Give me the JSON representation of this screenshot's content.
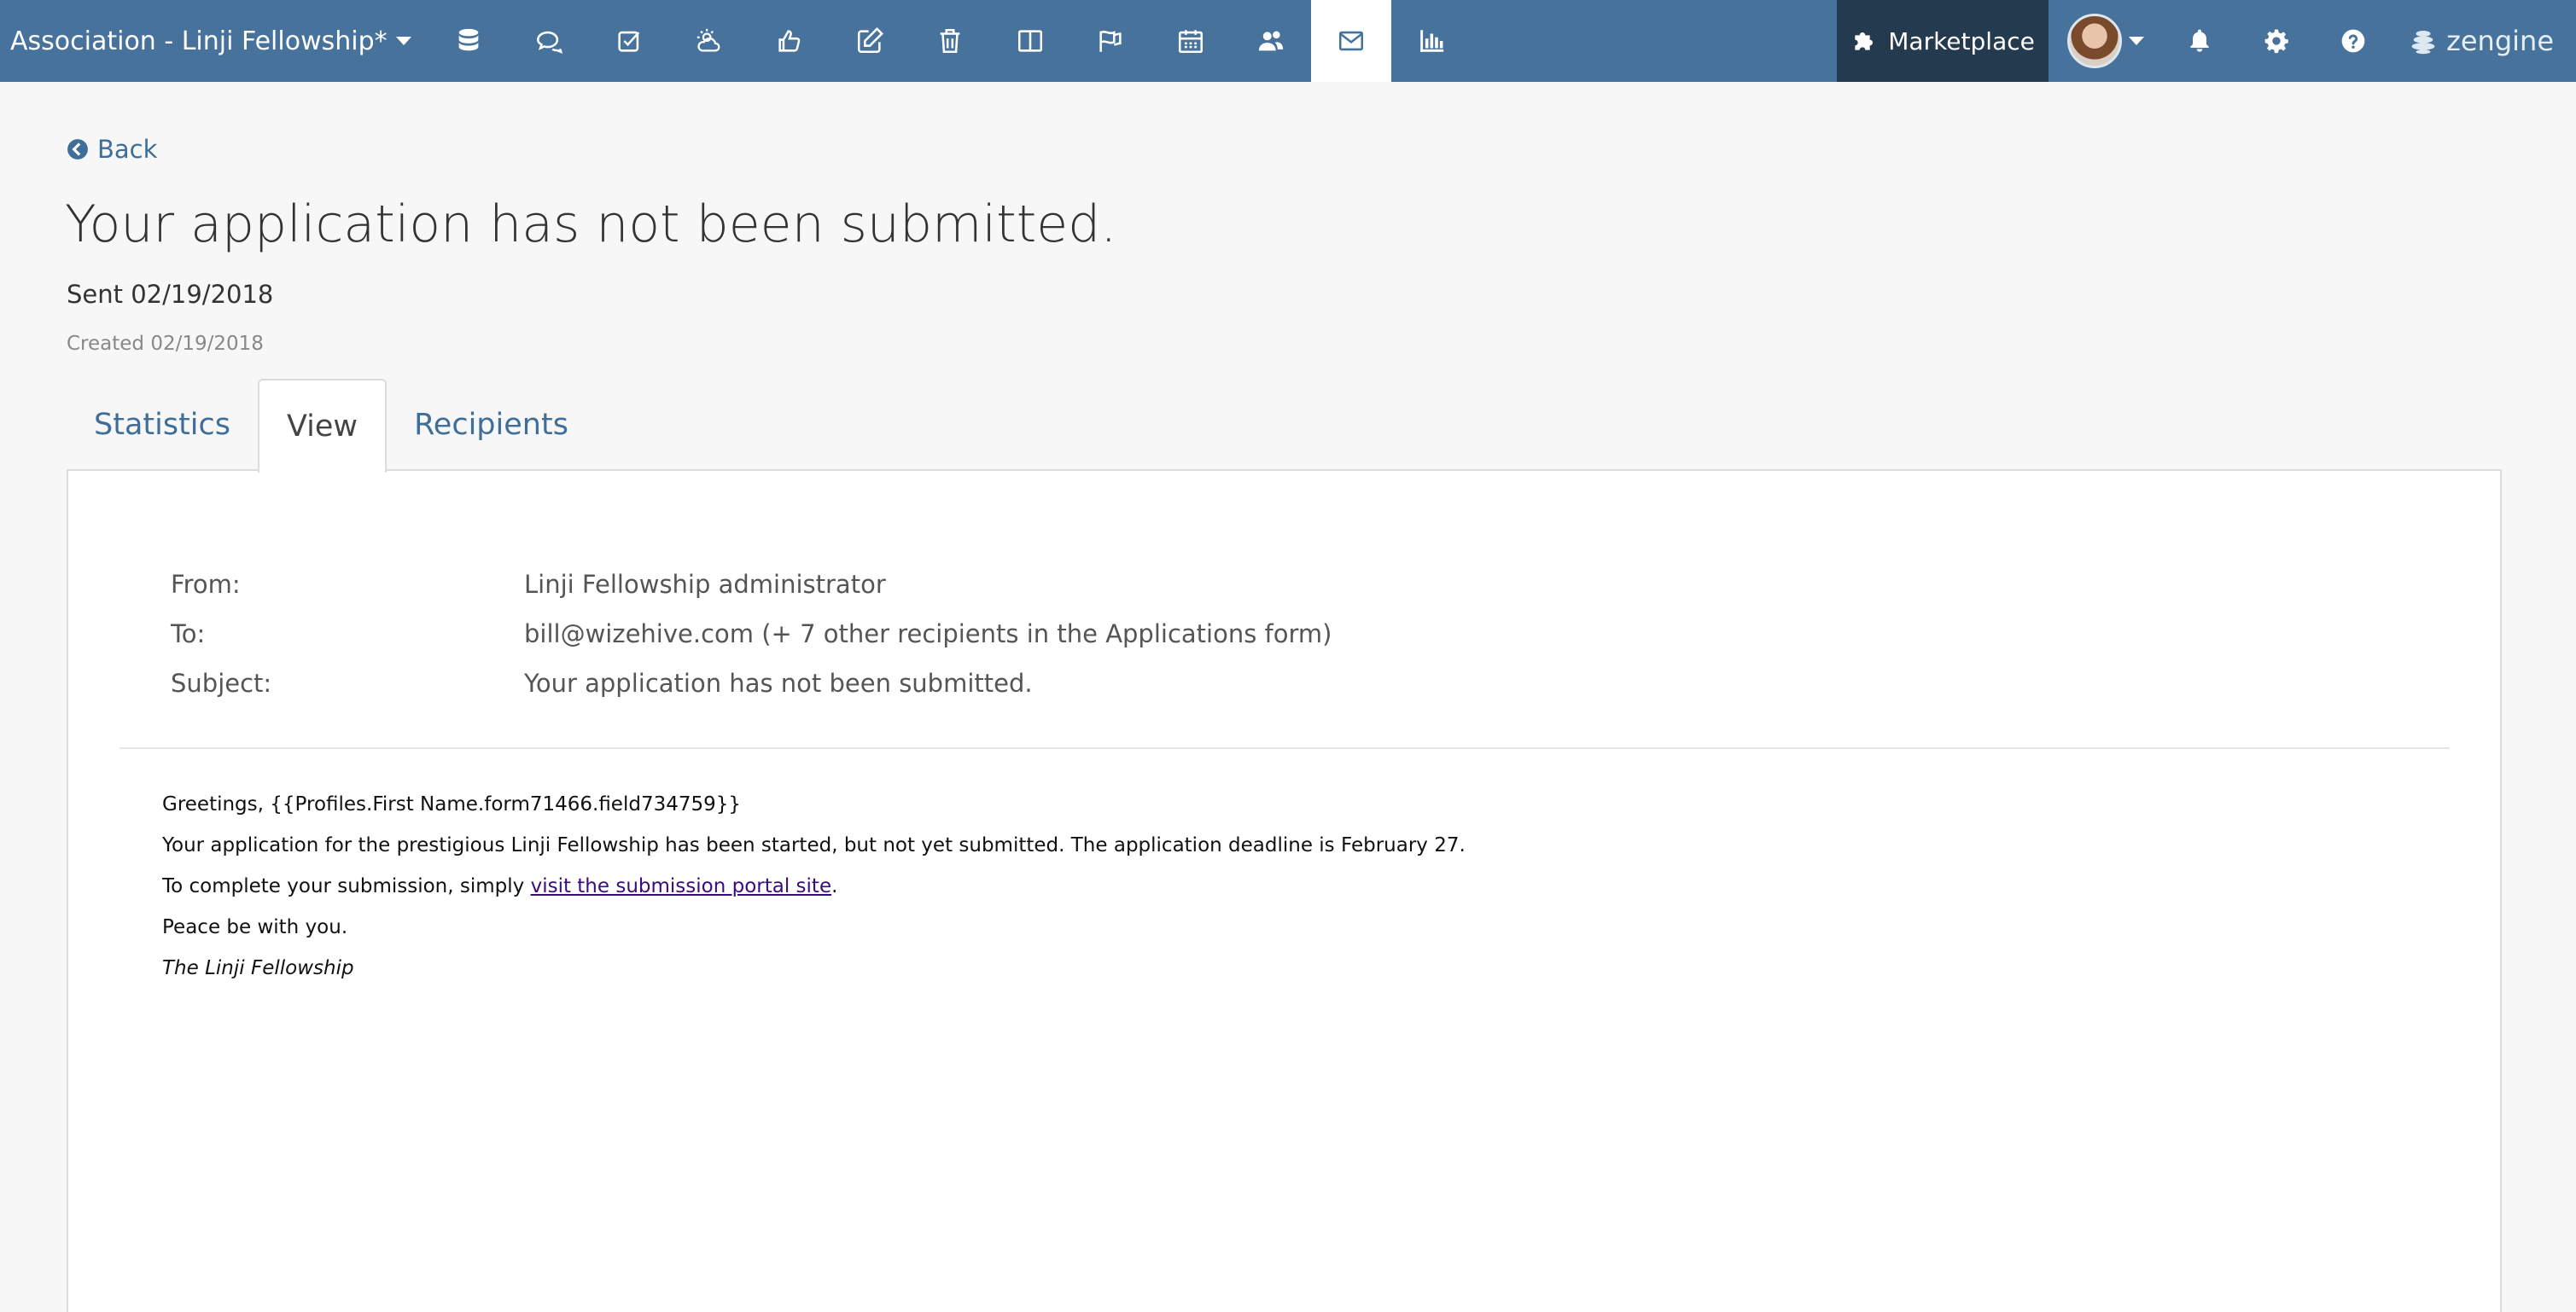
{
  "topbar": {
    "workspace_title": "Association - Linji Fellowship*",
    "nav_icons": [
      "database-icon",
      "comments-icon",
      "tasks-icon",
      "weather-icon",
      "thumbs-up-icon",
      "edit-icon",
      "trash-icon",
      "columns-icon",
      "flag-icon",
      "calendar-icon",
      "users-icon",
      "envelope-icon",
      "bar-chart-icon"
    ],
    "active_nav": "envelope-icon",
    "marketplace_label": "Marketplace",
    "brand_label": "zengine",
    "accent_color": "#46729b",
    "marketplace_color": "#243a4f"
  },
  "page": {
    "back_label": "Back",
    "title": "Your application has not been submitted.",
    "sent": "Sent 02/19/2018",
    "created": "Created 02/19/2018"
  },
  "tabs": [
    {
      "label": "Statistics",
      "active": false
    },
    {
      "label": "View",
      "active": true
    },
    {
      "label": "Recipients",
      "active": false
    }
  ],
  "email": {
    "from_label": "From:",
    "from_value": "Linji Fellowship administrator",
    "to_label": "To:",
    "to_value": "bill@wizehive.com (+ 7 other recipients in the Applications form)",
    "subject_label": "Subject:",
    "subject_value": "Your application has not been submitted.",
    "body": {
      "greeting": "Greetings, {{Profiles.First Name.form71466.field734759}}",
      "line1": "Your application for the prestigious Linji Fellowship has been started, but not yet submitted. The application deadline is February 27.",
      "line2_prefix": "To complete your submission, simply ",
      "line2_link": "visit the submission portal site",
      "line2_suffix": ".",
      "line3": "Peace be with you.",
      "signature": "The Linji Fellowship"
    }
  }
}
